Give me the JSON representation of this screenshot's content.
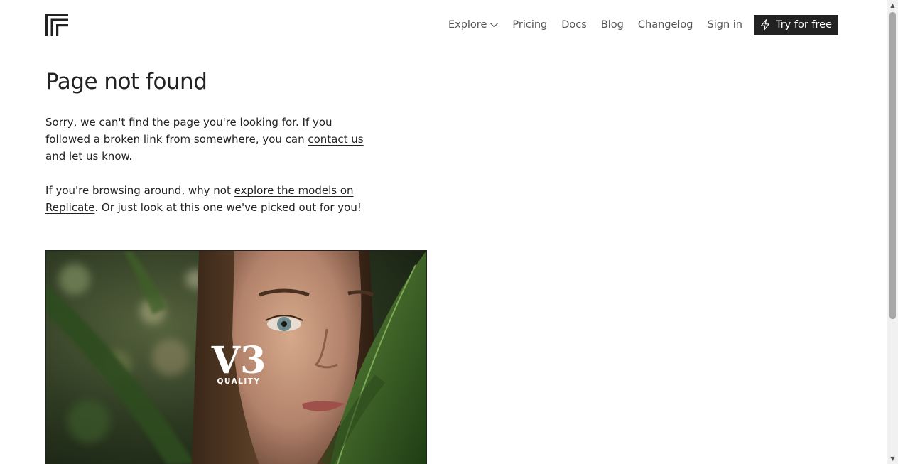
{
  "header": {
    "logo_name": "replicate-logo",
    "nav": {
      "explore": "Explore",
      "pricing": "Pricing",
      "docs": "Docs",
      "blog": "Blog",
      "changelog": "Changelog",
      "sign_in": "Sign in"
    },
    "cta_label": "Try for free"
  },
  "main": {
    "title": "Page not found",
    "para1_before": "Sorry, we can't find the page you're looking for. If you followed a broken link from somewhere, you can ",
    "para1_link": "contact us",
    "para1_after": " and let us know.",
    "para2_before": "If you're browsing around, why not ",
    "para2_link": "explore the models on Replicate",
    "para2_after": ". Or just look at this one we've picked out for you!"
  },
  "featured": {
    "overlay_title": "V3",
    "overlay_sub": "QUALITY"
  },
  "scrollbar": {
    "up_icon": "▲",
    "down_icon": "▼"
  },
  "colors": {
    "text": "#222222",
    "nav_text": "#555555",
    "cta_bg": "#222222",
    "cta_text": "#ffffff"
  }
}
